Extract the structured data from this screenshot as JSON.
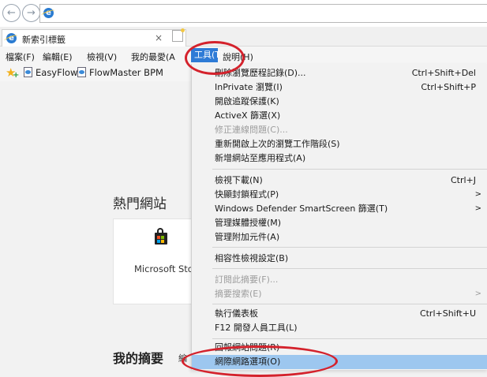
{
  "toolbar": {
    "back_icon": "back-arrow-icon",
    "forward_icon": "forward-arrow-icon",
    "address": ""
  },
  "tab": {
    "title": "新索引標籤",
    "close": "×"
  },
  "menubar": {
    "file": "檔案(F)",
    "edit": "編輯(E)",
    "view": "檢視(V)",
    "favorites": "我的最愛(A",
    "tools": "工具(T)",
    "help": "說明(H)"
  },
  "favorites_bar": {
    "links": [
      "EasyFlow",
      "FlowMaster BPM"
    ]
  },
  "page": {
    "hot_sites_title": "熱門網站",
    "tile_label": "Microsoft Sto",
    "digest_title": "我的摘要",
    "digest_sub": "編"
  },
  "tools_menu": {
    "group1": [
      {
        "label": "刪除瀏覽歷程記錄(D)...",
        "shortcut": "Ctrl+Shift+Del"
      },
      {
        "label": "InPrivate 瀏覽(I)",
        "shortcut": "Ctrl+Shift+P"
      },
      {
        "label": "開啟追蹤保護(K)",
        "shortcut": ""
      },
      {
        "label": "ActiveX 篩選(X)",
        "shortcut": ""
      },
      {
        "label": "修正連線問題(C)...",
        "shortcut": "",
        "disabled": true
      },
      {
        "label": "重新開啟上次的瀏覽工作階段(S)",
        "shortcut": ""
      },
      {
        "label": "新增網站至應用程式(A)",
        "shortcut": ""
      }
    ],
    "group2": [
      {
        "label": "檢視下載(N)",
        "shortcut": "Ctrl+J"
      },
      {
        "label": "快顯封鎖程式(P)",
        "submenu": true
      },
      {
        "label": "Windows Defender SmartScreen 篩選(T)",
        "submenu": true
      },
      {
        "label": "管理媒體授權(M)"
      },
      {
        "label": "管理附加元件(A)"
      }
    ],
    "group3": [
      {
        "label": "相容性檢視設定(B)"
      }
    ],
    "group4": [
      {
        "label": "訂閱此摘要(F)...",
        "disabled": true
      },
      {
        "label": "摘要搜索(E)",
        "disabled": true,
        "submenu": true
      }
    ],
    "group5": [
      {
        "label": "執行儀表板",
        "shortcut": "Ctrl+Shift+U"
      },
      {
        "label": "F12 開發人員工具(L)"
      }
    ],
    "group6": [
      {
        "label": "回報網站問題(R)"
      },
      {
        "label": "網際網路選項(O)",
        "highlighted": true
      }
    ],
    "submenu_arrow": ">"
  },
  "colors": {
    "menu_highlight": "#9dc7ef",
    "menubar_selected": "#2e7bd6",
    "annotation_ring": "#d4222c"
  }
}
